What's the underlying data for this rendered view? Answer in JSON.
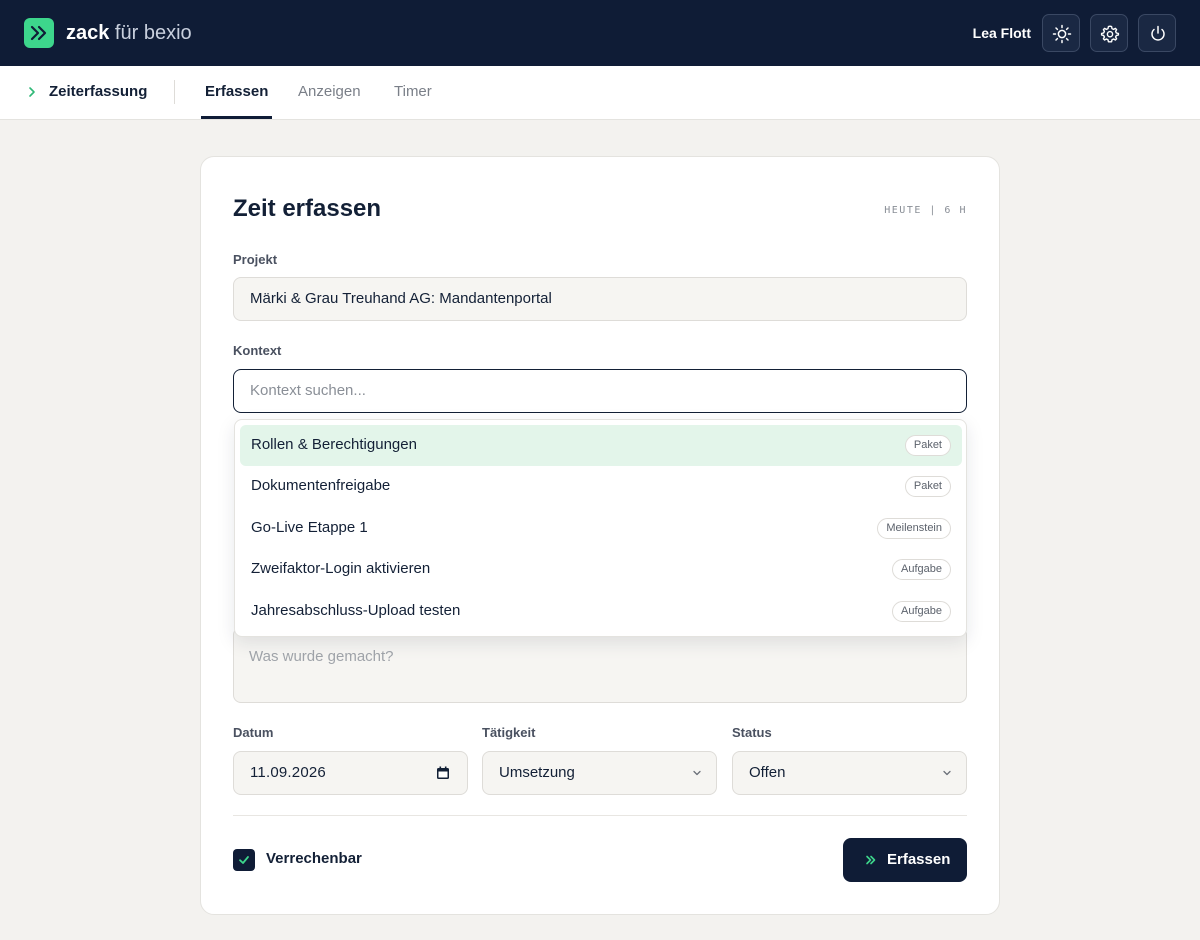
{
  "header": {
    "brand_bold": "zack",
    "brand_light": " für bexio",
    "user_name": "Lea Flott",
    "icons": [
      "sun-icon",
      "gear-icon",
      "power-icon"
    ],
    "accent_color": "#3dd68c",
    "nav_bg_color": "#0f1c36"
  },
  "subnav": {
    "section": "Zeiterfassung",
    "tabs": [
      {
        "label": "Erfassen",
        "active": true
      },
      {
        "label": "Anzeigen",
        "active": false
      },
      {
        "label": "Timer",
        "active": false
      }
    ]
  },
  "form": {
    "title": "Zeit erfassen",
    "today": "HEUTE | 6 H",
    "project_label": "Projekt",
    "project_value": "Märki & Grau Treuhand AG: Mandantenportal",
    "context_label": "Kontext",
    "context_placeholder": "Kontext suchen...",
    "notes_placeholder": "Was wurde gemacht?",
    "date_label": "Datum",
    "date_value": "11.09.2026",
    "activity_label": "Tätigkeit",
    "activity_value": "Umsetzung",
    "status_label": "Status",
    "status_value": "Offen",
    "billable_label": "Verrechenbar",
    "billable_checked": true,
    "submit_label": "Erfassen"
  },
  "dropdown": {
    "items": [
      {
        "label": "Rollen & Berechtigungen",
        "tag": "Paket",
        "highlighted": true
      },
      {
        "label": "Dokumentenfreigabe",
        "tag": "Paket",
        "highlighted": false
      },
      {
        "label": "Go-Live Etappe 1",
        "tag": "Meilenstein",
        "highlighted": false
      },
      {
        "label": "Zweifaktor-Login aktivieren",
        "tag": "Aufgabe",
        "highlighted": false
      },
      {
        "label": "Jahresabschluss-Upload testen",
        "tag": "Aufgabe",
        "highlighted": false
      }
    ]
  }
}
